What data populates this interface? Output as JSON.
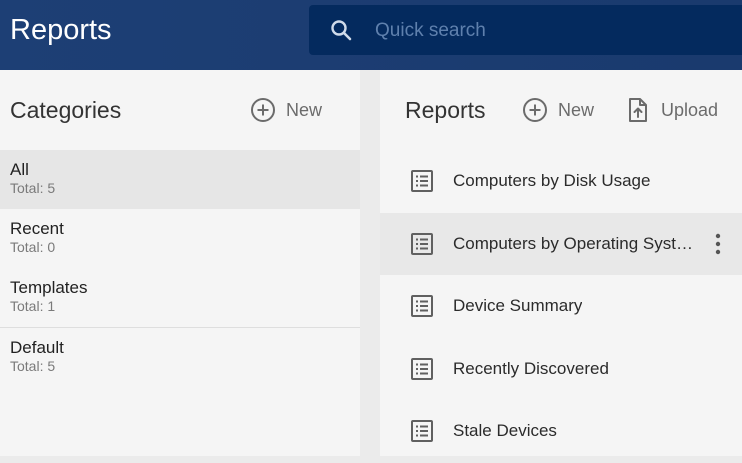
{
  "app": {
    "title": "Reports"
  },
  "search": {
    "placeholder": "Quick search",
    "value": ""
  },
  "categories": {
    "title": "Categories",
    "new_label": "New",
    "items": [
      {
        "name": "All",
        "total": "Total: 5"
      },
      {
        "name": "Recent",
        "total": "Total: 0"
      },
      {
        "name": "Templates",
        "total": "Total: 1"
      },
      {
        "name": "Default",
        "total": "Total: 5"
      }
    ]
  },
  "reports": {
    "title": "Reports",
    "new_label": "New",
    "upload_label": "Upload",
    "items": [
      {
        "name": "Computers by Disk Usage"
      },
      {
        "name": "Computers by Operating System"
      },
      {
        "name": "Device Summary"
      },
      {
        "name": "Recently Discovered"
      },
      {
        "name": "Stale Devices"
      }
    ]
  },
  "colors": {
    "header": "#1d3f75",
    "search_bg": "#042a5e",
    "panel_bg": "#f5f5f5",
    "selected_bg": "#e6e6e6"
  }
}
